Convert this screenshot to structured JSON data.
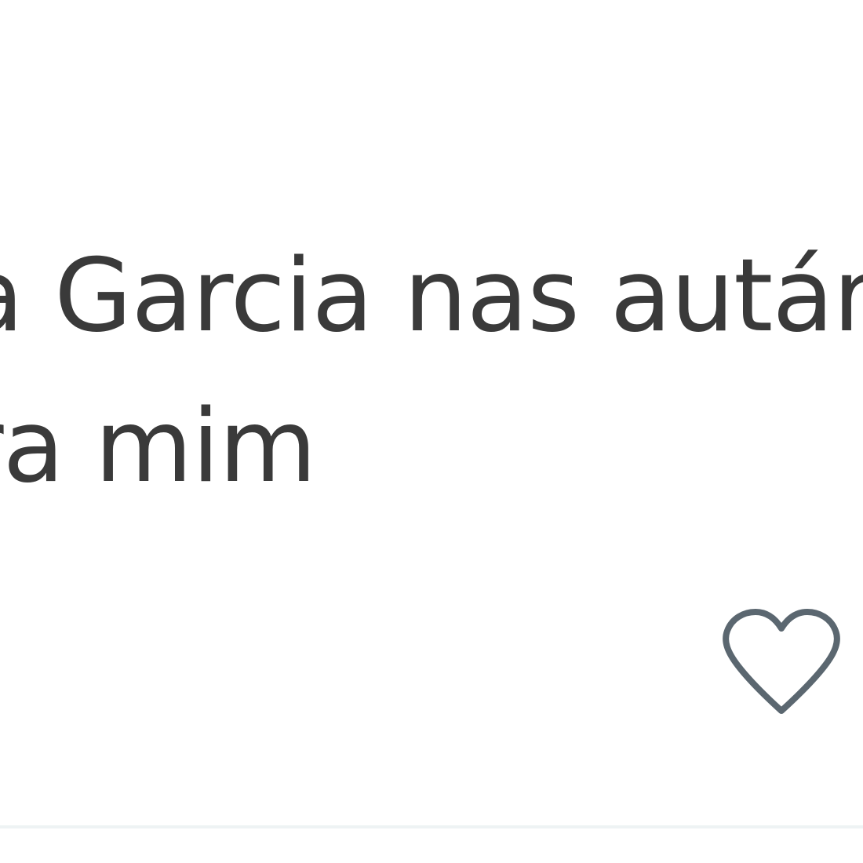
{
  "post": {
    "lines": [
      "a Garcia nas autárc",
      "ra mim"
    ]
  },
  "actions": {
    "like_icon": "heart-outline-icon",
    "like_icon_color": "#5b6770"
  },
  "colors": {
    "text": "#3a3a3a",
    "divider": "#eef3f4",
    "background": "#ffffff"
  }
}
